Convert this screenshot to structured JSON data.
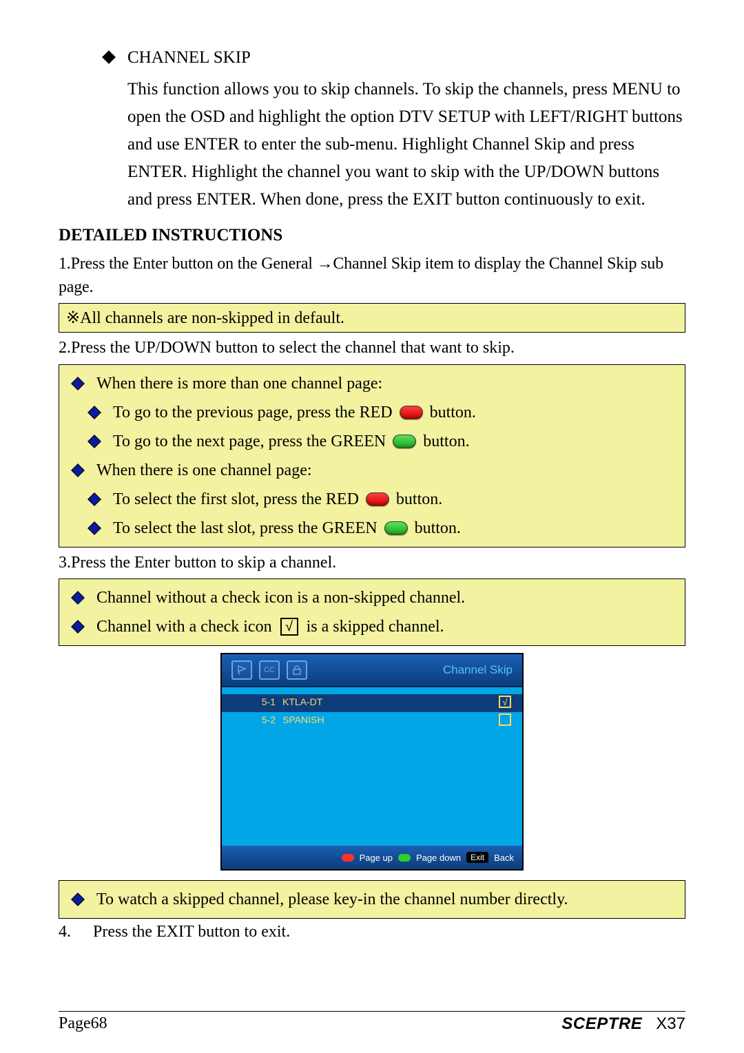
{
  "intro": {
    "title": "CHANNEL SKIP",
    "body": "This function allows you to skip channels. To skip the channels, press MENU to open the OSD and highlight the option DTV SETUP with LEFT/RIGHT buttons and use ENTER to enter the sub-menu. Highlight Channel Skip and press ENTER. Highlight the channel you want to skip with the UP/DOWN buttons and press ENTER. When done, press the EXIT button continuously to exit."
  },
  "heading": "DETAILED INSTRUCTIONS",
  "step1_a": "1.Press the Enter button on the General ",
  "step1_b": "Channel Skip item to display the Channel Skip sub page.",
  "note1_prefix": "※",
  "note1": "All channels are non-skipped in default.",
  "step2": "2.Press the UP/DOWN button to select the channel that want to skip.",
  "box2": {
    "l1": "When there is more than one channel page:",
    "l2a": "To go to the previous page, press the RED",
    "l2b": "button.",
    "l3a": "To go to the next page, press the GREEN",
    "l3b": "button.",
    "l4": "When there is one channel page:",
    "l5a": "To select the first slot, press the RED",
    "l5b": "button.",
    "l6a": "To select the last slot, press the GREEN",
    "l6b": "button."
  },
  "step3": "3.Press the Enter button to skip a channel.",
  "box3": {
    "l1": "Channel without a check icon is a non-skipped channel.",
    "l2a": "Channel with a check icon",
    "l2b": "is a skipped channel."
  },
  "osd": {
    "title": "Channel Skip",
    "cc_label": "CC",
    "rows": [
      {
        "num": "5-1",
        "name": "KTLA-DT",
        "checked": true
      },
      {
        "num": "5-2",
        "name": "SPANISH",
        "checked": false
      }
    ],
    "footer": {
      "pageup": "Page up",
      "pagedown": "Page down",
      "exit": "Exit",
      "back": "Back"
    }
  },
  "box4": "To watch a skipped channel, please key-in the channel number directly.",
  "step4_num": "4.",
  "step4_text": "Press the EXIT button to exit.",
  "footer": {
    "page": "Page68",
    "brand": "SCEPTRE",
    "model": "X37"
  },
  "check_glyph": "√",
  "arrow_glyph": "→"
}
